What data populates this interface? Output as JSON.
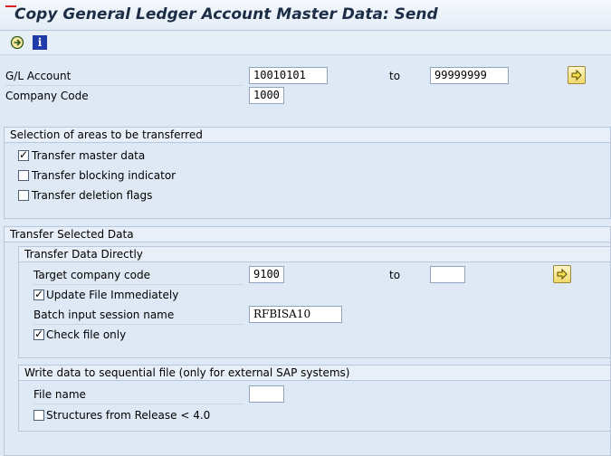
{
  "window": {
    "title": "Copy General Ledger Account Master Data: Send"
  },
  "toolbar": {
    "execute_icon": "execute-icon",
    "info_icon_glyph": "i"
  },
  "selection": {
    "gl_account_label": "G/L Account",
    "gl_account_from": "10010101",
    "to_label": "to",
    "gl_account_to": "99999999",
    "company_code_label": "Company Code",
    "company_code_value": "1000"
  },
  "areas": {
    "header": "Selection of areas to be transferred",
    "items": [
      {
        "label": "Transfer master data",
        "checked": true
      },
      {
        "label": "Transfer blocking indicator",
        "checked": false
      },
      {
        "label": "Transfer deletion flags",
        "checked": false
      }
    ]
  },
  "transfer": {
    "header": "Transfer Selected Data",
    "direct": {
      "header": "Transfer Data Directly",
      "target_label": "Target company code",
      "target_from": "9100",
      "to_label": "to",
      "target_to": "",
      "update_label": "Update File Immediately",
      "update_checked": true,
      "batch_label": "Batch input session name",
      "batch_value": "RFBISA10",
      "check_label": "Check file only",
      "check_checked": true
    },
    "sequential": {
      "header": "Write data to sequential file (only for external SAP systems)",
      "file_label": "File name",
      "file_value": "",
      "structures_label": "Structures from Release < 4.0",
      "structures_checked": false
    }
  }
}
